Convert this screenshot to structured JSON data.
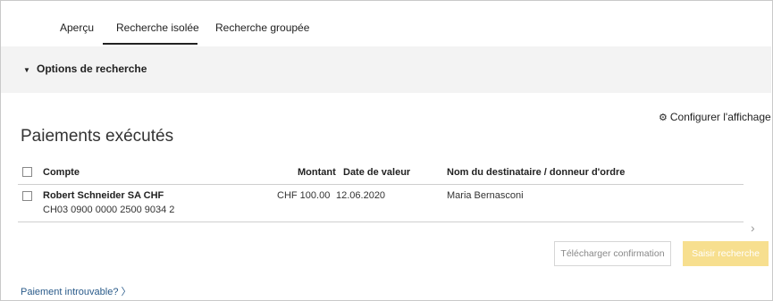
{
  "tabs": [
    {
      "label": "Aperçu"
    },
    {
      "label": "Recherche isolée",
      "active": true
    },
    {
      "label": "Recherche groupée"
    }
  ],
  "search_options": {
    "label": "Options de recherche",
    "caret_icon": "triangle-down-icon"
  },
  "configure_display": {
    "label": "Configurer l'affichage",
    "icon": "gear-icon"
  },
  "page_title": "Paiements exécutés",
  "table": {
    "headers": {
      "account": "Compte",
      "amount": "Montant",
      "value_date": "Date de valeur",
      "recipient": "Nom du destinataire / donneur d'ordre"
    },
    "rows": [
      {
        "account_name": "Robert Schneider SA CHF",
        "account_iban": "CH03 0900 0000 2500 9034 2",
        "amount": "CHF 100.00",
        "value_date": "12.06.2020",
        "recipient": "Maria Bernasconi"
      }
    ]
  },
  "buttons": {
    "download": "Télécharger confirmation",
    "search": "Saisir recherche"
  },
  "colors": {
    "primary_button": "#f7df8f",
    "link": "#2a5b8a",
    "options_bar": "#f3f3f3"
  },
  "not_found_link": "Paiement introuvable? 〉"
}
